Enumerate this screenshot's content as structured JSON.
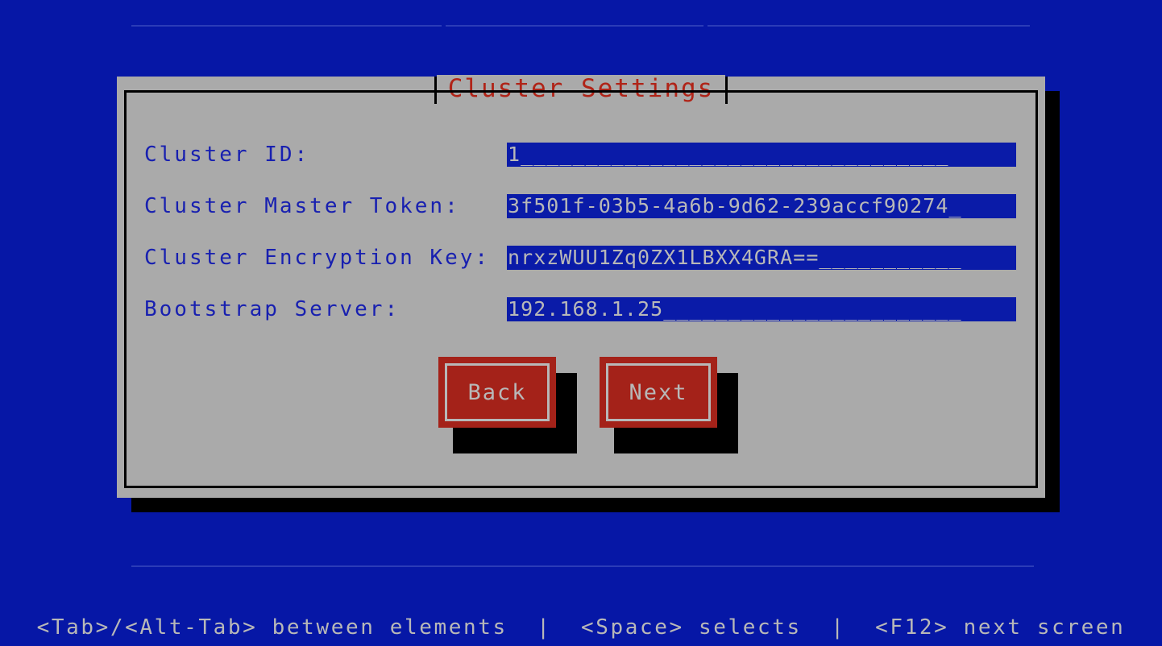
{
  "screen": {
    "background_color": "#0617a6",
    "rule_color": "#4a5bc4"
  },
  "dialog": {
    "title": "Cluster Settings",
    "title_color": "#b02418",
    "panel_color": "#aaaaaa",
    "label_color": "#1820b0",
    "fields": [
      {
        "name": "cluster-id",
        "label": "Cluster ID:",
        "value": "1_________________________________",
        "raw_value": "1"
      },
      {
        "name": "cluster-master-token",
        "label": "Cluster Master Token:",
        "value": "3f501f-03b5-4a6b-9d62-239accf90274_",
        "raw_value": "3f501f-03b5-4a6b-9d62-239accf90274"
      },
      {
        "name": "cluster-encryption-key",
        "label": "Cluster Encryption Key:",
        "value": "nrxzWUU1Zq0ZX1LBXX4GRA==___________",
        "raw_value": "nrxzWUU1Zq0ZX1LBXX4GRA=="
      },
      {
        "name": "bootstrap-server",
        "label": "Bootstrap Server:",
        "value": "192.168.1.25_______________________",
        "raw_value": "192.168.1.25"
      }
    ],
    "buttons": [
      {
        "name": "back",
        "label": "Back"
      },
      {
        "name": "next",
        "label": "Next"
      }
    ],
    "button_color": "#a42219",
    "button_text_color": "#b8b8b8"
  },
  "statusbar": {
    "text": "<Tab>/<Alt-Tab> between elements  |  <Space> selects  |  <F12> next screen",
    "text_color": "#b8b8b8"
  }
}
